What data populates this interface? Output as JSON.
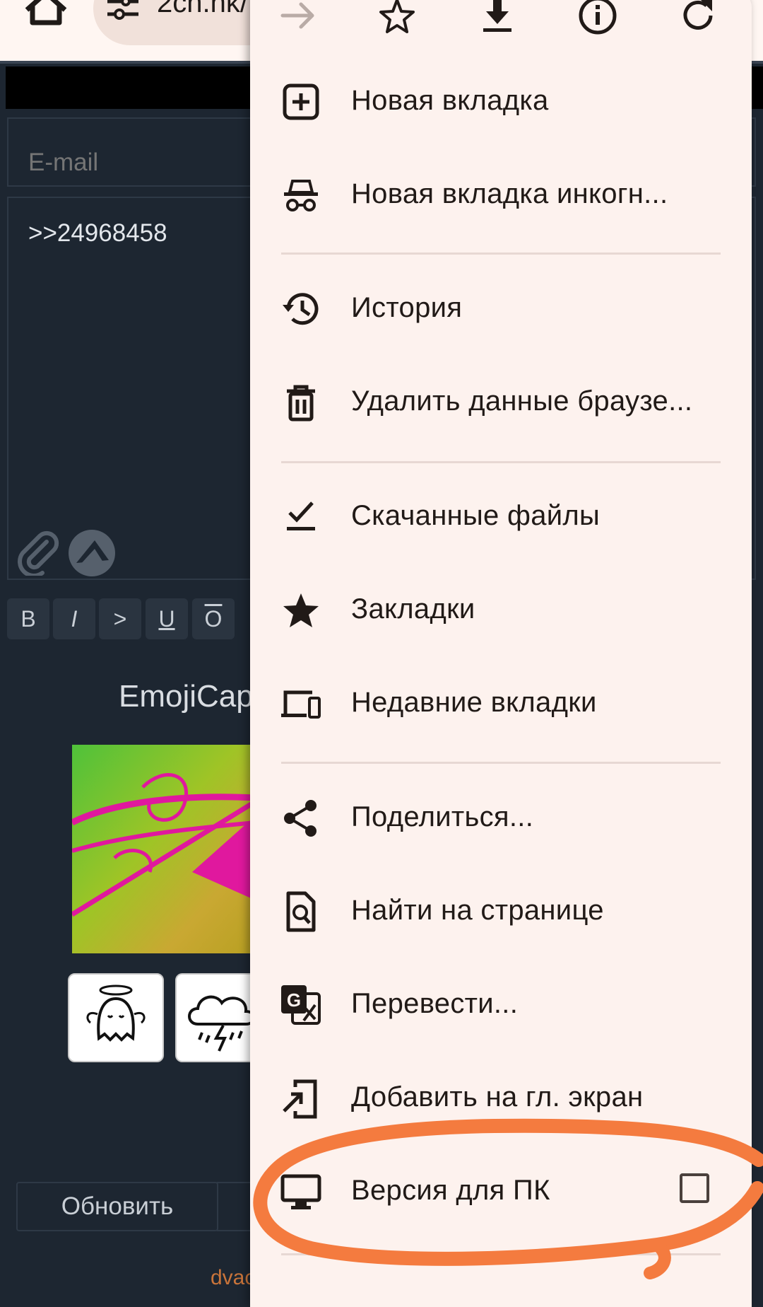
{
  "browser": {
    "url_text": "2ch.hk/"
  },
  "page": {
    "email_placeholder": "E-mail",
    "comment_text": ">>24968458",
    "format_buttons": [
      "B",
      "I",
      ">",
      "U",
      "O"
    ],
    "captcha_label": "EmojiCap",
    "refresh_label": "Обновить",
    "footer_text": "dvac"
  },
  "menu": {
    "toolbar_icons": [
      "arrow-forward-icon",
      "star-icon",
      "download-icon",
      "info-icon",
      "reload-icon"
    ],
    "items": [
      {
        "label": "Новая вкладка",
        "icon": "new-tab-icon"
      },
      {
        "label": "Новая вкладка инкогн...",
        "icon": "incognito-icon"
      },
      {
        "label": "История",
        "icon": "history-icon"
      },
      {
        "label": "Удалить данные браузе...",
        "icon": "trash-icon"
      },
      {
        "label": "Скачанные файлы",
        "icon": "downloads-icon"
      },
      {
        "label": "Закладки",
        "icon": "bookmarks-star-icon"
      },
      {
        "label": "Недавние вкладки",
        "icon": "devices-icon"
      },
      {
        "label": "Поделиться...",
        "icon": "share-icon"
      },
      {
        "label": "Найти на странице",
        "icon": "find-in-page-icon"
      },
      {
        "label": "Перевести...",
        "icon": "translate-icon"
      },
      {
        "label": "Добавить на гл. экран",
        "icon": "add-to-home-icon"
      },
      {
        "label": "Версия для ПК",
        "icon": "desktop-icon",
        "checked": false
      }
    ]
  },
  "colors": {
    "menu_bg": "#fdf2ee",
    "page_bg": "#1d2631",
    "highlight_stroke": "#f47b3f",
    "captcha_magenta": "#e0189e"
  }
}
